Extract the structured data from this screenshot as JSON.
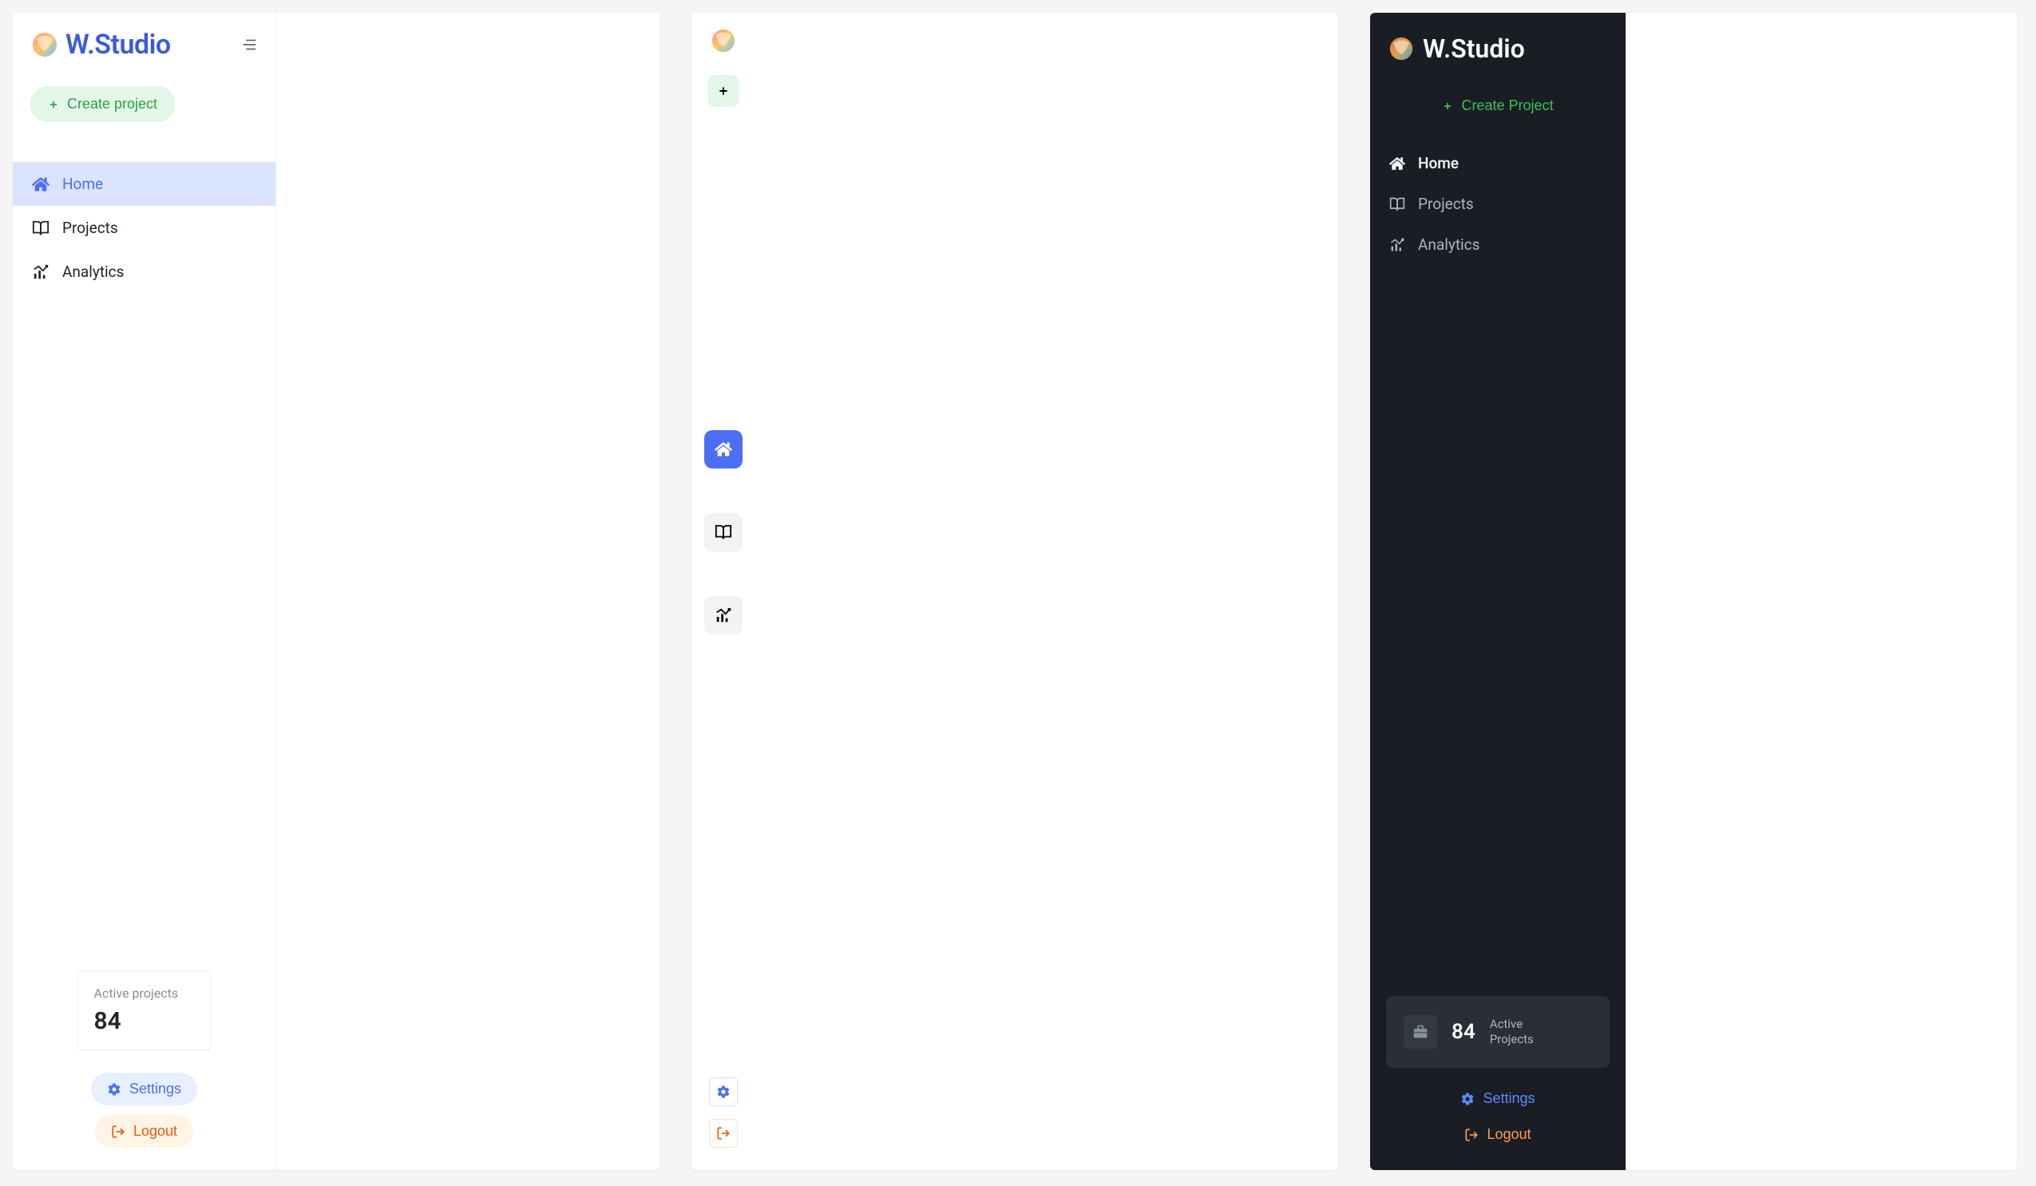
{
  "brand": {
    "name": "W.Studio",
    "prefix": "W",
    "suffix": ".Studio"
  },
  "panel1": {
    "create_label": "Create project",
    "nav": {
      "items": [
        {
          "label": "Home",
          "icon": "home-icon"
        },
        {
          "label": "Projects",
          "icon": "book-icon"
        },
        {
          "label": "Analytics",
          "icon": "chart-icon"
        }
      ]
    },
    "active_card": {
      "label": "Active projects",
      "value": "84"
    },
    "footer": {
      "settings_label": "Settings",
      "logout_label": "Logout"
    }
  },
  "panel3": {
    "create_label": "Create Project",
    "nav": {
      "items": [
        {
          "label": "Home",
          "icon": "home-icon"
        },
        {
          "label": "Projects",
          "icon": "book-icon"
        },
        {
          "label": "Analytics",
          "icon": "chart-icon"
        }
      ]
    },
    "active_card": {
      "label_line1": "Active",
      "label_line2": "Projects",
      "value": "84"
    },
    "footer": {
      "settings_label": "Settings",
      "logout_label": "Logout"
    }
  },
  "colors": {
    "primary_blue": "#4c6ef5",
    "green": "#2f9e44",
    "orange": "#e8590c",
    "dark_bg": "#1a1d24"
  }
}
